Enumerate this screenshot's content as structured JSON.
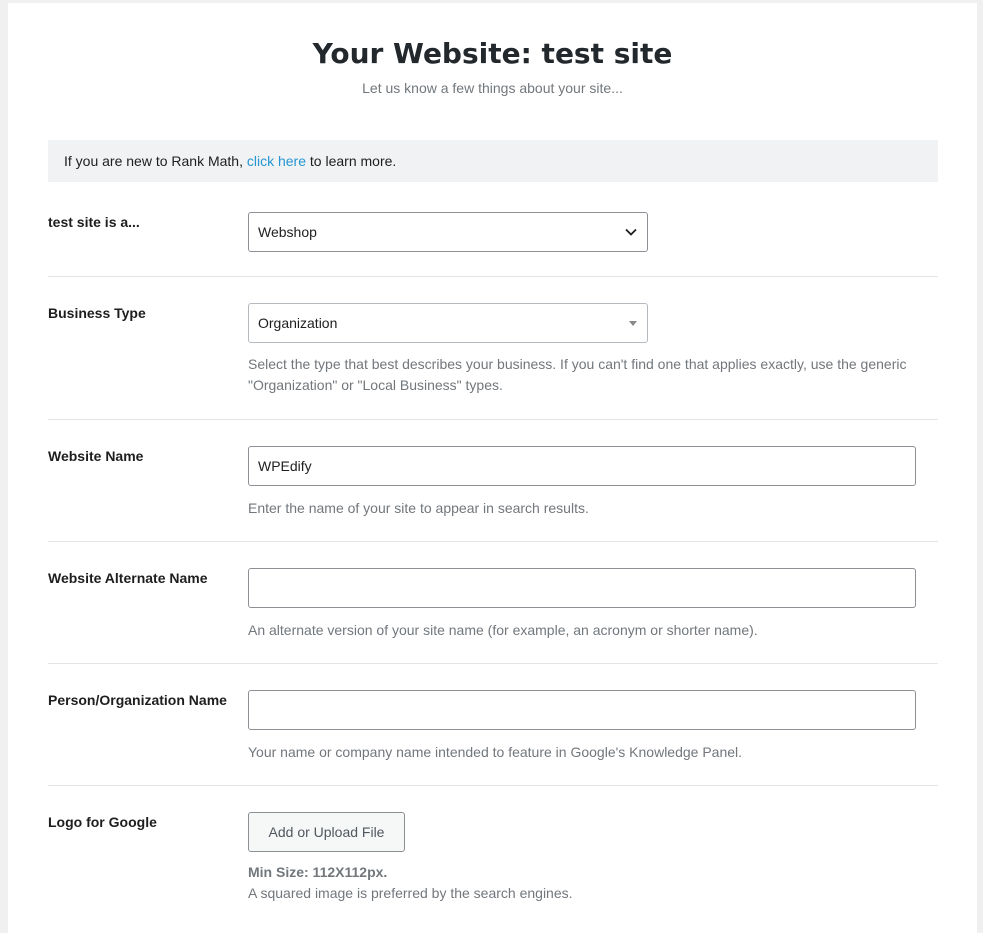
{
  "header": {
    "title": "Your Website: test site",
    "subtitle": "Let us know a few things about your site..."
  },
  "notice": {
    "text_before": "If you are new to Rank Math, ",
    "link_text": "click here",
    "text_after": " to learn more."
  },
  "fields": {
    "site_type": {
      "label": "test site is a...",
      "value": "Webshop",
      "icon": "chevron-down-icon"
    },
    "business_type": {
      "label": "Business Type",
      "value": "Organization",
      "icon": "triangle-down-icon",
      "description": "Select the type that best describes your business. If you can't find one that applies exactly, use the generic \"Organization\" or \"Local Business\" types."
    },
    "website_name": {
      "label": "Website Name",
      "value": "WPEdify",
      "description": "Enter the name of your site to appear in search results."
    },
    "website_alternate_name": {
      "label": "Website Alternate Name",
      "value": "",
      "description": "An alternate version of your site name (for example, an acronym or shorter name)."
    },
    "person_org_name": {
      "label": "Person/Organization Name",
      "value": "",
      "description": "Your name or company name intended to feature in Google's Knowledge Panel."
    },
    "logo": {
      "label": "Logo for Google",
      "button_label": "Add or Upload File",
      "min_size": "Min Size: 112X112px.",
      "description": "A squared image is preferred by the search engines."
    }
  },
  "colors": {
    "link": "#2596d2",
    "notice_bg": "#f1f2f4",
    "muted_text": "#72777c"
  }
}
